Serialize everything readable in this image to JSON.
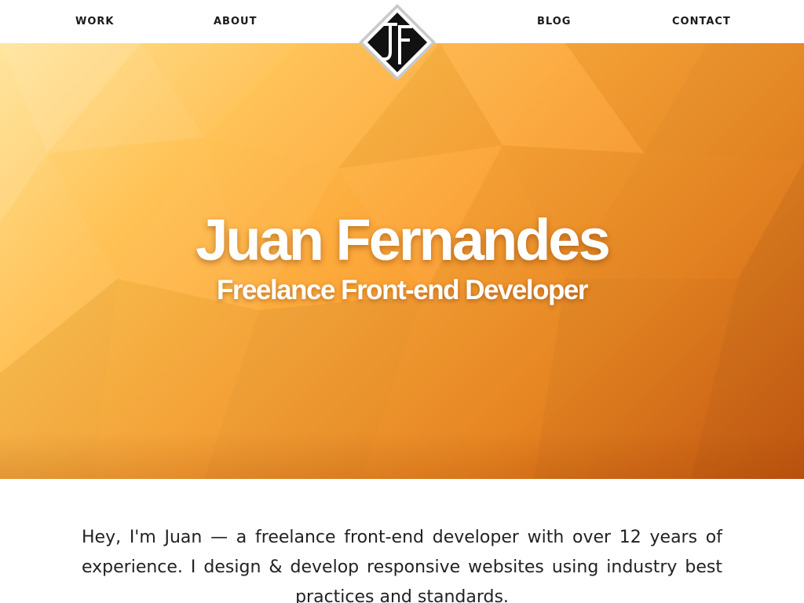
{
  "nav": {
    "left": [
      {
        "label": "WORK"
      },
      {
        "label": "ABOUT"
      }
    ],
    "right": [
      {
        "label": "BLOG"
      },
      {
        "label": "CONTACT"
      }
    ]
  },
  "logo": {
    "alt": "JF monogram logo"
  },
  "hero": {
    "title": "Juan Fernandes",
    "subtitle": "Freelance Front-end Developer"
  },
  "intro": {
    "text": "Hey, I'm Juan — a freelance front-end developer with over 12 years of experience. I design & develop responsive websites using industry best practices and standards."
  },
  "colors": {
    "accent": "#f39a2c",
    "nav_text": "#1a1a1a",
    "body_text": "#222222"
  }
}
